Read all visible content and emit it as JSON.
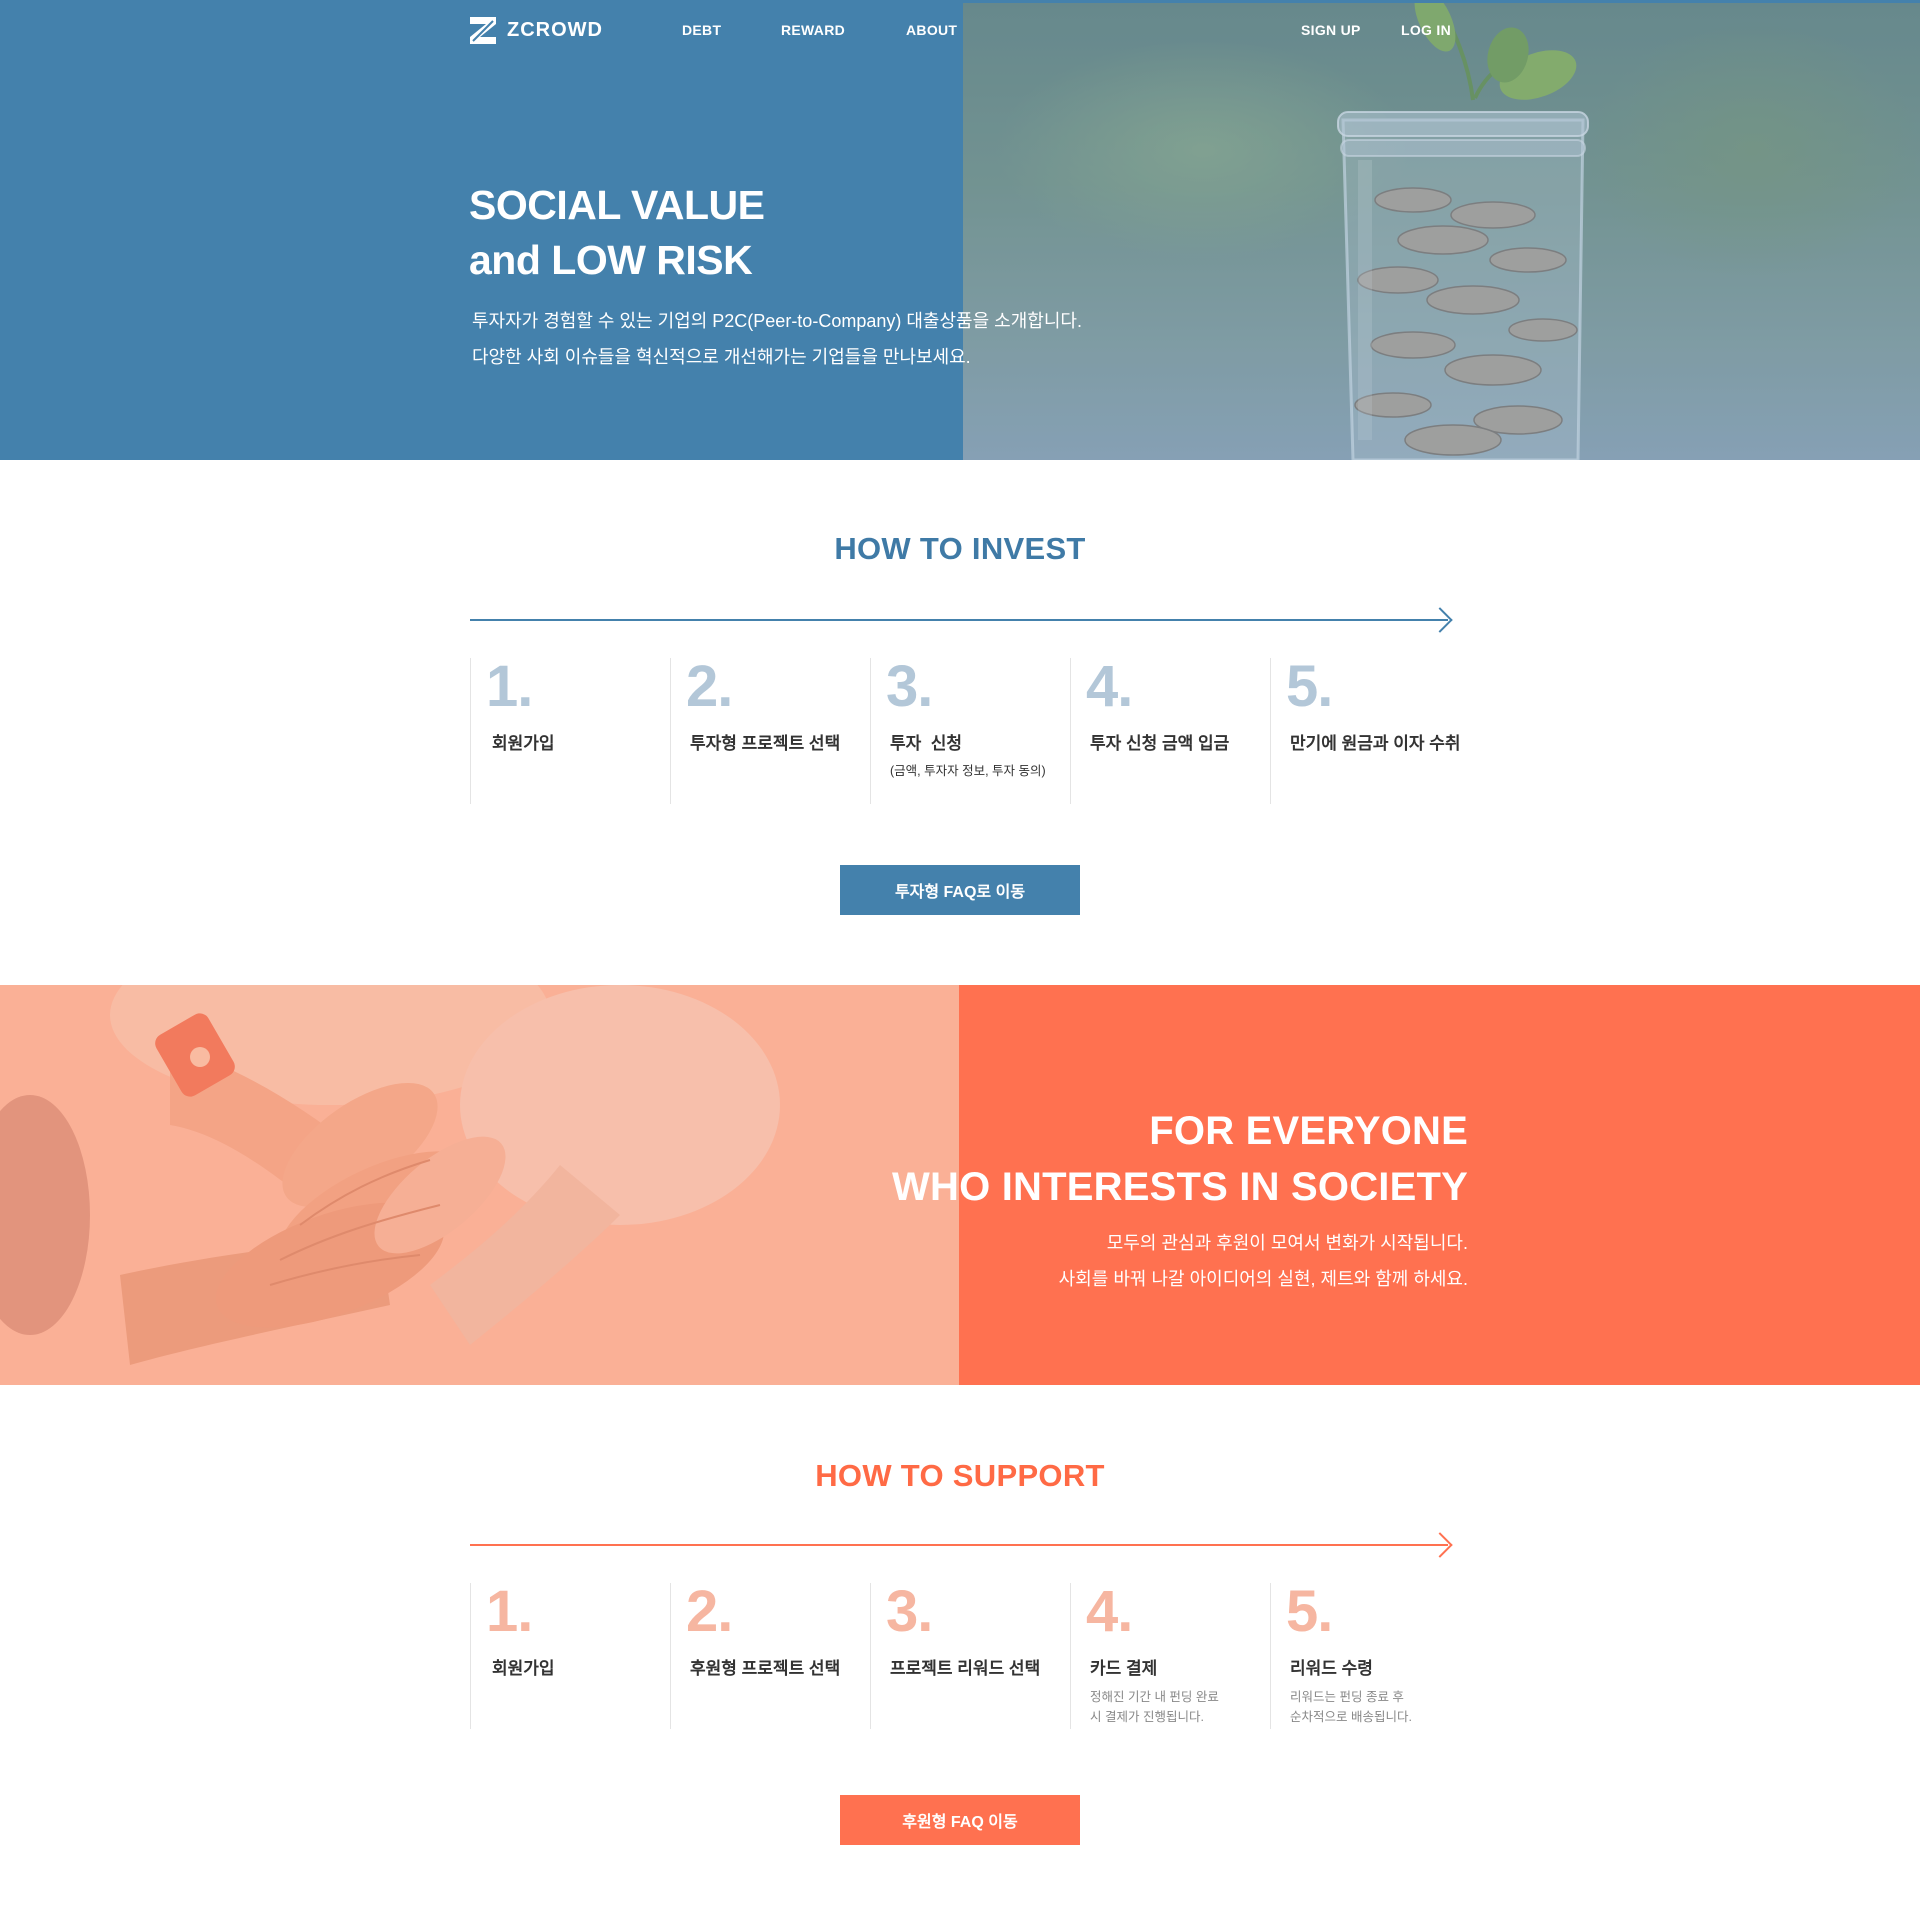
{
  "brand": {
    "name": "ZCROWD"
  },
  "nav": {
    "links": [
      "DEBT",
      "REWARD",
      "ABOUT"
    ],
    "auth": [
      "SIGN UP",
      "LOG IN"
    ]
  },
  "hero": {
    "title_line1": "SOCIAL VALUE",
    "title_line2": "and LOW RISK",
    "sub_line1": "투자자가 경험할 수 있는 기업의 P2C(Peer-to-Company) 대출상품을 소개합니다.",
    "sub_line2": "다양한 사회 이슈들을 혁신적으로 개선해가는 기업들을 만나보세요."
  },
  "invest": {
    "title": "HOW TO INVEST",
    "steps": [
      {
        "num": "1.",
        "label": "회원가입"
      },
      {
        "num": "2.",
        "label": "투자형 프로젝트 선택"
      },
      {
        "num": "3.",
        "label": "투자  신청",
        "note": "(금액, 투자자 정보, 투자 동의)"
      },
      {
        "num": "4.",
        "label": "투자 신청 금액 입금"
      },
      {
        "num": "5.",
        "label": "만기에 원금과 이자 수취"
      }
    ],
    "button": "투자형 FAQ로 이동"
  },
  "banner": {
    "title_line1": "FOR EVERYONE",
    "title_line2": "WHO INTERESTS IN SOCIETY",
    "sub_line1": "모두의 관심과 후원이 모여서 변화가 시작됩니다.",
    "sub_line2": "사회를 바꿔 나갈 아이디어의 실현, 제트와 함께 하세요."
  },
  "support": {
    "title": "HOW TO SUPPORT",
    "steps": [
      {
        "num": "1.",
        "label": "회원가입"
      },
      {
        "num": "2.",
        "label": "후원형 프로젝트 선택"
      },
      {
        "num": "3.",
        "label": "프로젝트 리워드 선택"
      },
      {
        "num": "4.",
        "label": "카드 결제",
        "note1": "정해진 기간 내 펀딩 완료",
        "note2": "시 결제가 진행됩니다."
      },
      {
        "num": "5.",
        "label": "리워드 수령",
        "note1": "리워드는 펀딩 종료 후",
        "note2": "순차적으로 배송됩니다."
      }
    ],
    "button": "후원형 FAQ 이동"
  },
  "colors": {
    "blue": "#4481ac",
    "blue_light": "#b3c7d8",
    "orange": "#ff7150",
    "orange_light": "#f9b49b",
    "peach_num": "#f6b6a1"
  },
  "icons": [
    "logo-mark-icon",
    "arrow-right-icon"
  ]
}
